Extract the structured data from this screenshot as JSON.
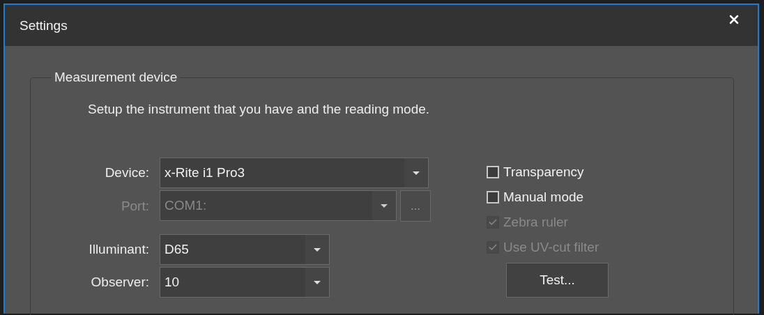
{
  "window": {
    "title": "Settings"
  },
  "group": {
    "title": "Measurement device",
    "description": "Setup the instrument that you have and the reading mode.",
    "fields": [
      {
        "label": "Device:",
        "value": "x-Rite i1 Pro3",
        "disabled": false
      },
      {
        "label": "Port:",
        "value": "COM1:",
        "disabled": true,
        "browse_button": "..."
      },
      {
        "label": "Illuminant:",
        "value": "D65",
        "disabled": false
      },
      {
        "label": "Observer:",
        "value": "10",
        "disabled": false
      }
    ],
    "options": [
      {
        "label": "Transparency",
        "checked": false,
        "disabled": false
      },
      {
        "label": "Manual mode",
        "checked": false,
        "disabled": false
      },
      {
        "label": "Zebra ruler",
        "checked": true,
        "disabled": true
      },
      {
        "label": "Use UV-cut filter",
        "checked": true,
        "disabled": true
      }
    ],
    "test_button": "Test..."
  }
}
